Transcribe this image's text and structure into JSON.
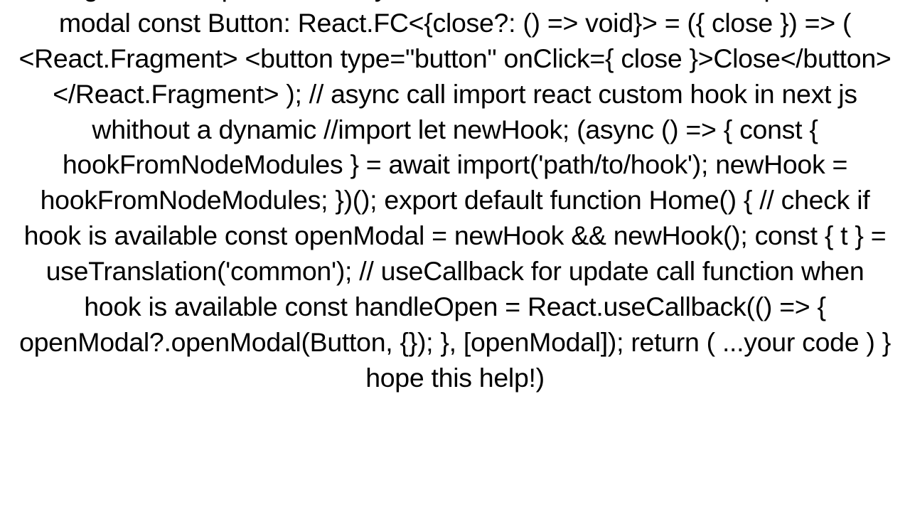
{
  "document": {
    "text": "facing whith this problem today, and what that i done:  //test component for modal  const Button: React.FC<{close?: () => void}> = ({ close }) => (   <React.Fragment>     <button type=\"button\" onClick={ close }>Close</button>   </React.Fragment> );  // async call import react custom hook in next js whithout a dynamic  //import let newHook;  (async () => {  const { hookFromNodeModules } =   await import('path/to/hook');   newHook = hookFromNodeModules; })();  export default function Home() { // check if hook is available const openModal = newHook && newHook();  const { t } = useTranslation('common');  // useCallback for update call function when hook is available const handleOpen = React.useCallback(() => {     openModal?.openModal(Button, {}); }, [openModal]);   return ( ...your code ) }  hope this help!)"
  }
}
